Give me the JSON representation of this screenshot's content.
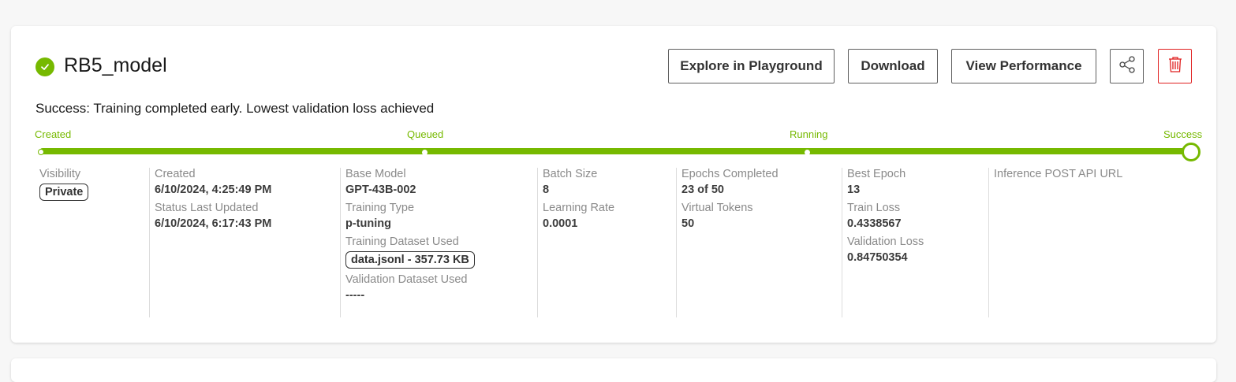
{
  "job": {
    "name": "RB5_model",
    "status_icon": "check-circle-icon",
    "status_color": "#76b900",
    "message": "Success: Training completed early. Lowest validation loss achieved"
  },
  "actions": {
    "explore": "Explore in Playground",
    "download": "Download",
    "performance": "View Performance",
    "share_icon": "share-icon",
    "delete_icon": "trash-icon",
    "delete_color": "#e02020"
  },
  "progress": {
    "stages": [
      "Created",
      "Queued",
      "Running",
      "Success"
    ],
    "completed_fraction": 1.0,
    "accent": "#76b900"
  },
  "details": {
    "visibility": {
      "label": "Visibility",
      "value": "Private"
    },
    "created": {
      "label": "Created",
      "value": "6/10/2024, 4:25:49 PM"
    },
    "status_updated": {
      "label": "Status Last Updated",
      "value": "6/10/2024, 6:17:43 PM"
    },
    "base_model": {
      "label": "Base Model",
      "value": "GPT-43B-002"
    },
    "training_type": {
      "label": "Training Type",
      "value": "p-tuning"
    },
    "training_dataset": {
      "label": "Training Dataset Used",
      "value": "data.jsonl - 357.73 KB"
    },
    "validation_dataset": {
      "label": "Validation Dataset Used",
      "value": "-----"
    },
    "batch_size": {
      "label": "Batch Size",
      "value": "8"
    },
    "learning_rate": {
      "label": "Learning Rate",
      "value": "0.0001"
    },
    "epochs": {
      "label": "Epochs Completed",
      "value": "23 of 50"
    },
    "virtual_tokens": {
      "label": "Virtual Tokens",
      "value": "50"
    },
    "best_epoch": {
      "label": "Best Epoch",
      "value": "13"
    },
    "train_loss": {
      "label": "Train Loss",
      "value": "0.4338567"
    },
    "validation_loss": {
      "label": "Validation Loss",
      "value": "0.84750354"
    },
    "inference_url": {
      "label": "Inference POST API URL",
      "value": ""
    }
  }
}
